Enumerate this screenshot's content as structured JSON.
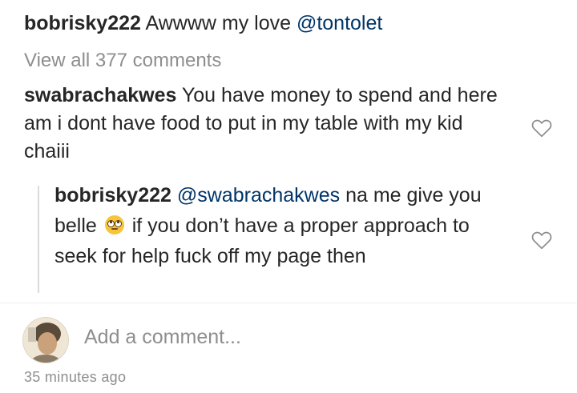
{
  "top_partial": {
    "text": "bobrisky222 Awwww my love @tontolet"
  },
  "comments": [
    {
      "username": "bobrisky222",
      "text": " Awwww my love ",
      "mention": "@tontolet"
    },
    {
      "username": "swabrachakwes",
      "text": " You have money to spend and here am i dont have food to put in my table with my kid chaiii"
    }
  ],
  "view_all": {
    "label": "View all 377 comments"
  },
  "reply": {
    "username": "bobrisky222",
    "mention": "@swabrachakwes",
    "text_a": " na me give you belle ",
    "emoji": "face-with-rolling-eyes",
    "text_b": " if you don’t have a proper approach to seek for help fuck off my page then"
  },
  "composer": {
    "placeholder": "Add a comment..."
  },
  "timestamp": "35 minutes ago",
  "colors": {
    "text": "#262626",
    "muted": "#8e8e8e",
    "mention": "#003569",
    "divider": "#dbdbdb"
  },
  "icons": [
    "heart-outline-icon",
    "heart-outline-icon",
    "avatar"
  ]
}
